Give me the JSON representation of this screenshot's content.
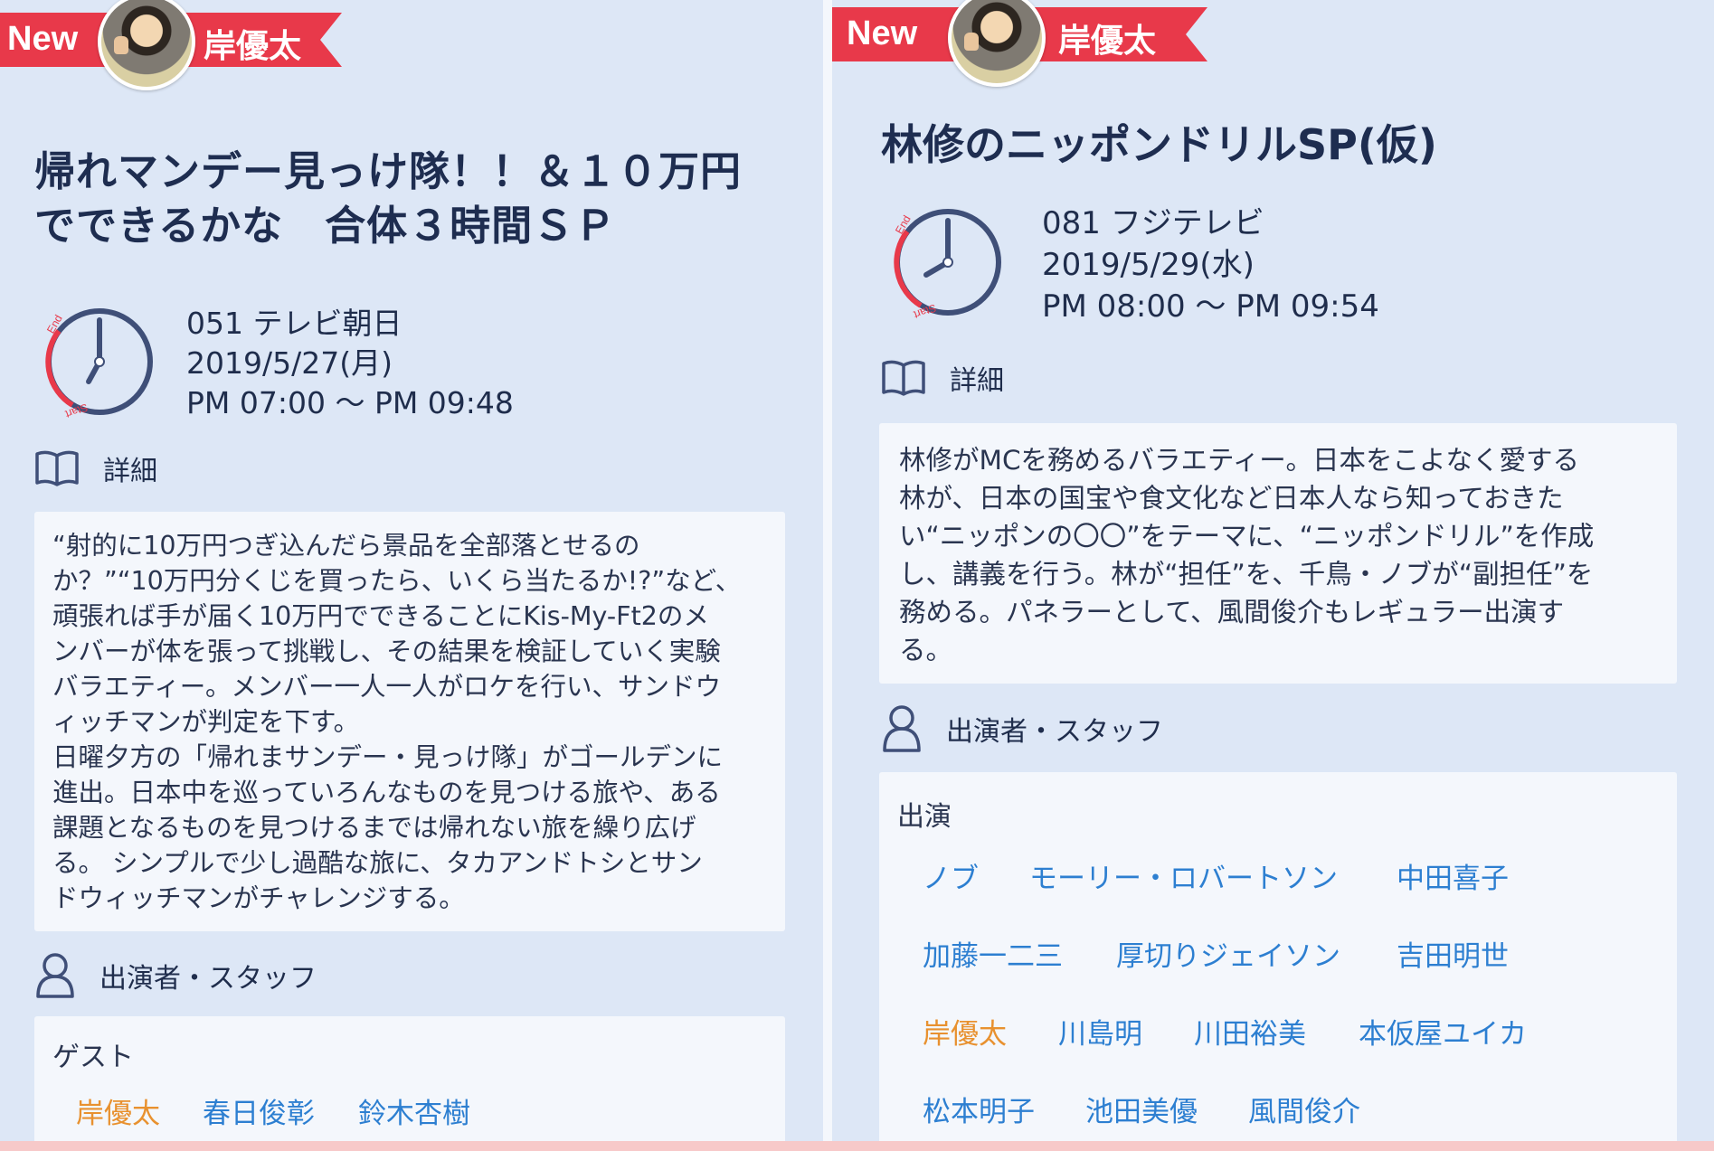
{
  "colors": {
    "accent_red": "#e8394a",
    "link_blue": "#2d7fd1",
    "highlight_orange": "#e8912f",
    "background": "#dde7f6",
    "card": "#f4f7fc"
  },
  "left": {
    "badge_new": "New",
    "badge_name": "岸優太",
    "title_line1": "帰れマンデー見っけ隊！！＆１０万円",
    "title_line2": "でできるかな　合体３時間ＳＰ",
    "channel": "051 テレビ朝日",
    "date": "2019/5/27(月)",
    "time": "PM 07:00 ～ PM 09:48",
    "clock_end": "End",
    "clock_start": "Start",
    "detail_heading": "詳細",
    "description": "“射的に10万円つぎ込んだら景品を全部落とせるの\nか？”“10万円分くじを買ったら、いくら当たるか!?”など、\n頑張れば手が届く10万円でできることにKis-My-Ft2のメ\nンバーが体を張って挑戦し、その結果を検証していく実験\nバラエティー。メンバー一人一人がロケを行い、サンドウ\nィッチマンが判定を下す。\n日曜夕方の「帰れまサンデー・見っけ隊」がゴールデンに\n進出。日本中を巡っていろんなものを見つける旅や、ある\n課題となるものを見つけるまでは帰れない旅を繰り広げ\nる。 シンプルで少し過酷な旅に、タカアンドトシとサン\nドウィッチマンがチャレンジする。",
    "cast_heading": "出演者・スタッフ",
    "cast_role": "ゲスト",
    "cast": [
      "岸優太",
      "春日俊彰",
      "鈴木杏樹"
    ]
  },
  "right": {
    "badge_new": "New",
    "badge_name": "岸優太",
    "title": "林修のニッポンドリルSP(仮)",
    "channel": "081 フジテレビ",
    "date": "2019/5/29(水)",
    "time": "PM 08:00 ～ PM 09:54",
    "clock_end": "End",
    "clock_start": "Start",
    "detail_heading": "詳細",
    "description": "林修がMCを務めるバラエティー。日本をこよなく愛する\n林が、日本の国宝や食文化など日本人なら知っておきた\nい“ニッポンの〇〇”をテーマに、“ニッポンドリル”を作成\nし、講義を行う。林が“担任”を、千鳥・ノブが“副担任”を\n務める。パネラーとして、風間俊介もレギュラー出演す\nる。",
    "cast_heading": "出演者・スタッフ",
    "cast_role": "出演",
    "cast": [
      "ノブ",
      "モーリー・ロバートソン",
      "中田喜子",
      "加藤一二三",
      "厚切りジェイソン",
      "吉田明世",
      "岸優太",
      "川島明",
      "川田裕美",
      "本仮屋ユイカ",
      "松本明子",
      "池田美優",
      "風間俊介"
    ]
  }
}
